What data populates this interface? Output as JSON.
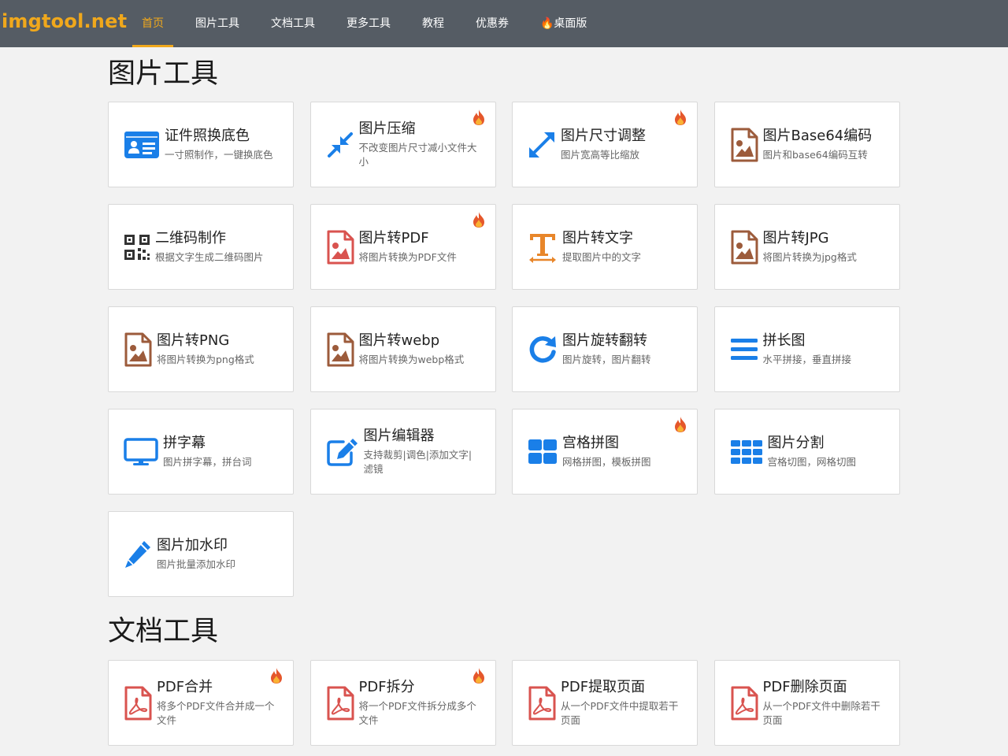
{
  "brand": "imgtool.net",
  "nav": [
    {
      "label": "首页",
      "active": true
    },
    {
      "label": "图片工具"
    },
    {
      "label": "文档工具"
    },
    {
      "label": "更多工具"
    },
    {
      "label": "教程"
    },
    {
      "label": "优惠券"
    },
    {
      "label": "🔥桌面版"
    }
  ],
  "sections": [
    {
      "title": "图片工具",
      "cards": [
        {
          "title": "证件照换底色",
          "desc": "一寸照制作，一键换底色",
          "icon": "id-card-icon",
          "hot": false
        },
        {
          "title": "图片压缩",
          "desc": "不改变图片尺寸减小文件大小",
          "icon": "compress-icon",
          "hot": true
        },
        {
          "title": "图片尺寸调整",
          "desc": "图片宽高等比缩放",
          "icon": "expand-icon",
          "hot": true
        },
        {
          "title": "图片Base64编码",
          "desc": "图片和base64编码互转",
          "icon": "image-file-icon",
          "hot": false
        },
        {
          "title": "二维码制作",
          "desc": "根据文字生成二维码图片",
          "icon": "qrcode-icon",
          "hot": false
        },
        {
          "title": "图片转PDF",
          "desc": "将图片转换为PDF文件",
          "icon": "pdf-image-icon",
          "hot": true
        },
        {
          "title": "图片转文字",
          "desc": "提取图片中的文字",
          "icon": "text-icon",
          "hot": false
        },
        {
          "title": "图片转JPG",
          "desc": "将图片转换为jpg格式",
          "icon": "image-file-icon",
          "hot": false
        },
        {
          "title": "图片转PNG",
          "desc": "将图片转换为png格式",
          "icon": "image-file-icon",
          "hot": false
        },
        {
          "title": "图片转webp",
          "desc": "将图片转换为webp格式",
          "icon": "image-file-icon",
          "hot": false
        },
        {
          "title": "图片旋转翻转",
          "desc": "图片旋转，图片翻转",
          "icon": "rotate-icon",
          "hot": false
        },
        {
          "title": "拼长图",
          "desc": "水平拼接，垂直拼接",
          "icon": "bars-icon",
          "hot": false
        },
        {
          "title": "拼字幕",
          "desc": "图片拼字幕，拼台词",
          "icon": "monitor-icon",
          "hot": false
        },
        {
          "title": "图片编辑器",
          "desc": "支持裁剪|调色|添加文字|滤镜",
          "icon": "edit-icon",
          "hot": false
        },
        {
          "title": "宫格拼图",
          "desc": "网格拼图，模板拼图",
          "icon": "grid4-icon",
          "hot": true
        },
        {
          "title": "图片分割",
          "desc": "宫格切图，网格切图",
          "icon": "grid9-icon",
          "hot": false
        },
        {
          "title": "图片加水印",
          "desc": "图片批量添加水印",
          "icon": "pencil-icon",
          "hot": false
        }
      ]
    },
    {
      "title": "文档工具",
      "cards": [
        {
          "title": "PDF合并",
          "desc": "将多个PDF文件合并成一个文件",
          "icon": "pdf-file-icon",
          "hot": true
        },
        {
          "title": "PDF拆分",
          "desc": "将一个PDF文件拆分成多个文件",
          "icon": "pdf-file-icon",
          "hot": true
        },
        {
          "title": "PDF提取页面",
          "desc": "从一个PDF文件中提取若干页面",
          "icon": "pdf-file-icon",
          "hot": false
        },
        {
          "title": "PDF删除页面",
          "desc": "从一个PDF文件中删除若干页面",
          "icon": "pdf-file-icon",
          "hot": false
        }
      ]
    }
  ],
  "colors": {
    "navbar": "#555c64",
    "brand": "#f0a81c",
    "blue": "#1a7fe8",
    "brown": "#9c5b3b",
    "red": "#d9534f",
    "orange": "#e8862a",
    "dark": "#333333"
  }
}
